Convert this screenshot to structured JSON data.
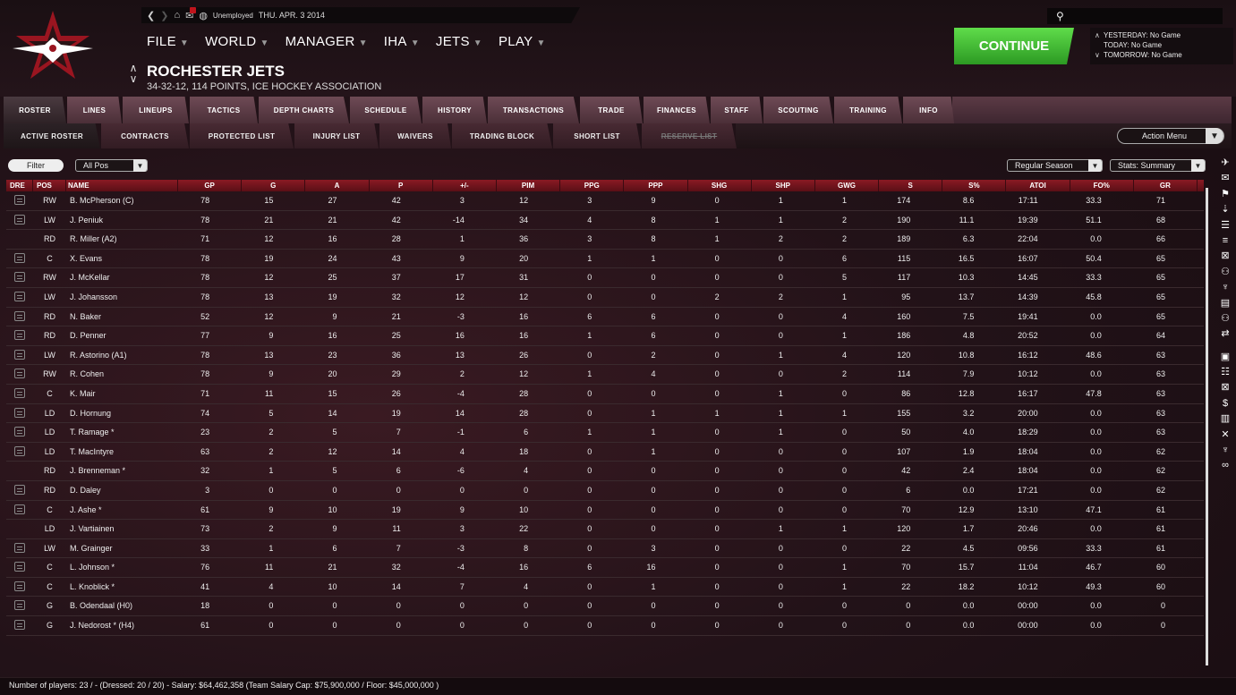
{
  "header": {
    "nav": {
      "status": "Unemployed",
      "date": "THU. APR. 3 2014"
    },
    "menu": [
      {
        "label": "FILE"
      },
      {
        "label": "WORLD"
      },
      {
        "label": "MANAGER"
      },
      {
        "label": "IHA"
      },
      {
        "label": "JETS"
      },
      {
        "label": "PLAY"
      }
    ],
    "team": {
      "name": "ROCHESTER JETS",
      "subtitle": "34-32-12, 114 POINTS, ICE HOCKEY ASSOCIATION"
    },
    "continue_label": "CONTINUE",
    "schedule": {
      "yesterday": "YESTERDAY: No Game",
      "today": "TODAY: No Game",
      "tomorrow": "TOMORROW: No Game"
    }
  },
  "tabs_primary": [
    {
      "label": "ROSTER",
      "active": true
    },
    {
      "label": "LINES"
    },
    {
      "label": "LINEUPS"
    },
    {
      "label": "TACTICS"
    },
    {
      "label": "DEPTH CHARTS"
    },
    {
      "label": "SCHEDULE"
    },
    {
      "label": "HISTORY"
    },
    {
      "label": "TRANSACTIONS"
    },
    {
      "label": "TRADE"
    },
    {
      "label": "FINANCES"
    },
    {
      "label": "STAFF"
    },
    {
      "label": "SCOUTING"
    },
    {
      "label": "TRAINING"
    },
    {
      "label": "INFO"
    }
  ],
  "tabs_secondary": [
    {
      "label": "ACTIVE ROSTER",
      "active": true
    },
    {
      "label": "CONTRACTS"
    },
    {
      "label": "PROTECTED LIST"
    },
    {
      "label": "INJURY LIST"
    },
    {
      "label": "WAIVERS"
    },
    {
      "label": "TRADING BLOCK"
    },
    {
      "label": "SHORT LIST"
    },
    {
      "label": "RESERVE LIST",
      "disabled": true
    }
  ],
  "action_menu": "Action Menu",
  "filters": {
    "filter_label": "Filter",
    "position": "All Pos",
    "season": "Regular Season",
    "stats": "Stats: Summary"
  },
  "table": {
    "columns": [
      "DRE",
      "POS",
      "NAME",
      "GP",
      "G",
      "A",
      "P",
      "+/-",
      "PIM",
      "PPG",
      "PPP",
      "SHG",
      "SHP",
      "GWG",
      "S",
      "S%",
      "ATOI",
      "FO%",
      "GR"
    ],
    "rows": [
      {
        "dressed": true,
        "cells": [
          "RW",
          "B. McPherson (C)",
          "78",
          "15",
          "27",
          "42",
          "3",
          "12",
          "3",
          "9",
          "0",
          "1",
          "1",
          "174",
          "8.6",
          "17:11",
          "33.3",
          "71"
        ]
      },
      {
        "dressed": true,
        "cells": [
          "LW",
          "J. Peniuk",
          "78",
          "21",
          "21",
          "42",
          "-14",
          "34",
          "4",
          "8",
          "1",
          "1",
          "2",
          "190",
          "11.1",
          "19:39",
          "51.1",
          "68"
        ]
      },
      {
        "dressed": false,
        "cells": [
          "RD",
          "R. Miller (A2)",
          "71",
          "12",
          "16",
          "28",
          "1",
          "36",
          "3",
          "8",
          "1",
          "2",
          "2",
          "189",
          "6.3",
          "22:04",
          "0.0",
          "66"
        ]
      },
      {
        "dressed": true,
        "cells": [
          "C",
          "X. Evans",
          "78",
          "19",
          "24",
          "43",
          "9",
          "20",
          "1",
          "1",
          "0",
          "0",
          "6",
          "115",
          "16.5",
          "16:07",
          "50.4",
          "65"
        ]
      },
      {
        "dressed": true,
        "cells": [
          "RW",
          "J. McKellar",
          "78",
          "12",
          "25",
          "37",
          "17",
          "31",
          "0",
          "0",
          "0",
          "0",
          "5",
          "117",
          "10.3",
          "14:45",
          "33.3",
          "65"
        ]
      },
      {
        "dressed": true,
        "cells": [
          "LW",
          "J. Johansson",
          "78",
          "13",
          "19",
          "32",
          "12",
          "12",
          "0",
          "0",
          "2",
          "2",
          "1",
          "95",
          "13.7",
          "14:39",
          "45.8",
          "65"
        ]
      },
      {
        "dressed": true,
        "cells": [
          "RD",
          "N. Baker",
          "52",
          "12",
          "9",
          "21",
          "-3",
          "16",
          "6",
          "6",
          "0",
          "0",
          "4",
          "160",
          "7.5",
          "19:41",
          "0.0",
          "65"
        ]
      },
      {
        "dressed": true,
        "cells": [
          "RD",
          "D. Penner",
          "77",
          "9",
          "16",
          "25",
          "16",
          "16",
          "1",
          "6",
          "0",
          "0",
          "1",
          "186",
          "4.8",
          "20:52",
          "0.0",
          "64"
        ]
      },
      {
        "dressed": true,
        "cells": [
          "LW",
          "R. Astorino (A1)",
          "78",
          "13",
          "23",
          "36",
          "13",
          "26",
          "0",
          "2",
          "0",
          "1",
          "4",
          "120",
          "10.8",
          "16:12",
          "48.6",
          "63"
        ]
      },
      {
        "dressed": true,
        "cells": [
          "RW",
          "R. Cohen",
          "78",
          "9",
          "20",
          "29",
          "2",
          "12",
          "1",
          "4",
          "0",
          "0",
          "2",
          "114",
          "7.9",
          "10:12",
          "0.0",
          "63"
        ]
      },
      {
        "dressed": true,
        "cells": [
          "C",
          "K. Mair",
          "71",
          "11",
          "15",
          "26",
          "-4",
          "28",
          "0",
          "0",
          "0",
          "1",
          "0",
          "86",
          "12.8",
          "16:17",
          "47.8",
          "63"
        ]
      },
      {
        "dressed": true,
        "cells": [
          "LD",
          "D. Hornung",
          "74",
          "5",
          "14",
          "19",
          "14",
          "28",
          "0",
          "1",
          "1",
          "1",
          "1",
          "155",
          "3.2",
          "20:00",
          "0.0",
          "63"
        ]
      },
      {
        "dressed": true,
        "cells": [
          "LD",
          "T. Ramage *",
          "23",
          "2",
          "5",
          "7",
          "-1",
          "6",
          "1",
          "1",
          "0",
          "1",
          "0",
          "50",
          "4.0",
          "18:29",
          "0.0",
          "63"
        ]
      },
      {
        "dressed": true,
        "cells": [
          "LD",
          "T. MacIntyre",
          "63",
          "2",
          "12",
          "14",
          "4",
          "18",
          "0",
          "1",
          "0",
          "0",
          "0",
          "107",
          "1.9",
          "18:04",
          "0.0",
          "62"
        ]
      },
      {
        "dressed": false,
        "cells": [
          "RD",
          "J. Brenneman *",
          "32",
          "1",
          "5",
          "6",
          "-6",
          "4",
          "0",
          "0",
          "0",
          "0",
          "0",
          "42",
          "2.4",
          "18:04",
          "0.0",
          "62"
        ]
      },
      {
        "dressed": true,
        "cells": [
          "RD",
          "D. Daley",
          "3",
          "0",
          "0",
          "0",
          "0",
          "0",
          "0",
          "0",
          "0",
          "0",
          "0",
          "6",
          "0.0",
          "17:21",
          "0.0",
          "62"
        ]
      },
      {
        "dressed": true,
        "cells": [
          "C",
          "J. Ashe *",
          "61",
          "9",
          "10",
          "19",
          "9",
          "10",
          "0",
          "0",
          "0",
          "0",
          "0",
          "70",
          "12.9",
          "13:10",
          "47.1",
          "61"
        ]
      },
      {
        "dressed": false,
        "cells": [
          "LD",
          "J. Vartiainen",
          "73",
          "2",
          "9",
          "11",
          "3",
          "22",
          "0",
          "0",
          "0",
          "1",
          "1",
          "120",
          "1.7",
          "20:46",
          "0.0",
          "61"
        ]
      },
      {
        "dressed": true,
        "cells": [
          "LW",
          "M. Grainger",
          "33",
          "1",
          "6",
          "7",
          "-3",
          "8",
          "0",
          "3",
          "0",
          "0",
          "0",
          "22",
          "4.5",
          "09:56",
          "33.3",
          "61"
        ]
      },
      {
        "dressed": true,
        "cells": [
          "C",
          "L. Johnson *",
          "76",
          "11",
          "21",
          "32",
          "-4",
          "16",
          "6",
          "16",
          "0",
          "0",
          "1",
          "70",
          "15.7",
          "11:04",
          "46.7",
          "60"
        ]
      },
      {
        "dressed": true,
        "cells": [
          "C",
          "L. Knoblick *",
          "41",
          "4",
          "10",
          "14",
          "7",
          "4",
          "0",
          "1",
          "0",
          "0",
          "1",
          "22",
          "18.2",
          "10:12",
          "49.3",
          "60"
        ]
      },
      {
        "dressed": true,
        "cells": [
          "G",
          "B. Odendaal (H0)",
          "18",
          "0",
          "0",
          "0",
          "0",
          "0",
          "0",
          "0",
          "0",
          "0",
          "0",
          "0",
          "0.0",
          "00:00",
          "0.0",
          "0"
        ]
      },
      {
        "dressed": true,
        "cells": [
          "G",
          "J. Nedorost * (H4)",
          "61",
          "0",
          "0",
          "0",
          "0",
          "0",
          "0",
          "0",
          "0",
          "0",
          "0",
          "0",
          "0.0",
          "00:00",
          "0.0",
          "0"
        ]
      }
    ]
  },
  "footer": "Number of players: 23 / - (Dressed: 20 / 20)  -  Salary: $64,462,358  (Team Salary Cap: $75,900,000 / Floor: $45,000,000 )",
  "sidebar_icons": [
    "logo-icon",
    "mail-icon",
    "bookmark-icon",
    "tactics-icon",
    "roster-icon",
    "lines-icon",
    "depth-icon",
    "staff-icon",
    "trophy-icon",
    "report-icon",
    "finance-people-icon",
    "trade-icon",
    "team-logo-icon",
    "list-icon",
    "schedule-icon",
    "dollar-icon",
    "chart-icon",
    "sticks-icon",
    "award-icon",
    "binoculars-icon"
  ]
}
